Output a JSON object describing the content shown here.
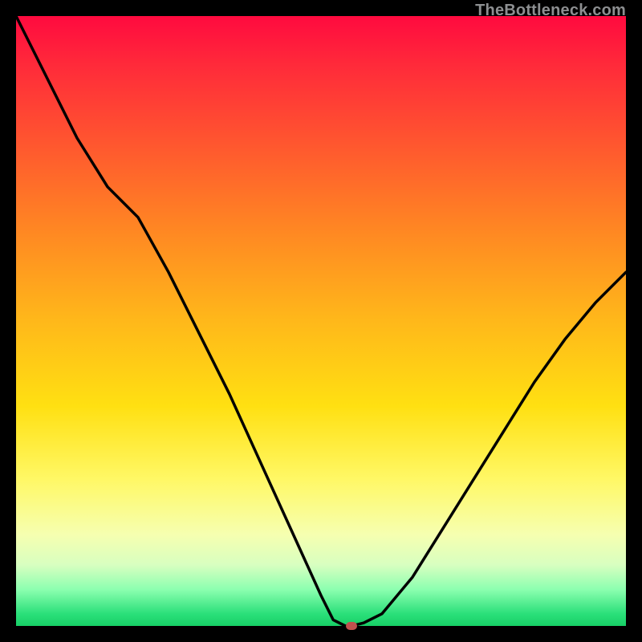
{
  "watermark": "TheBottleneck.com",
  "colors": {
    "frame_bg": "#000000",
    "gradient_top": "#ff0a3f",
    "gradient_bottom": "#17cf66",
    "curve_stroke": "#000000",
    "marker_fill": "#c0514e"
  },
  "chart_data": {
    "type": "line",
    "title": "",
    "xlabel": "",
    "ylabel": "",
    "xlim": [
      0,
      100
    ],
    "ylim": [
      0,
      100
    ],
    "x": [
      0,
      5,
      10,
      15,
      20,
      25,
      30,
      35,
      40,
      45,
      50,
      52,
      54,
      55,
      57,
      60,
      65,
      70,
      75,
      80,
      85,
      90,
      95,
      100
    ],
    "values": [
      100,
      90,
      80,
      72,
      67,
      58,
      48,
      38,
      27,
      16,
      5,
      1,
      0,
      0,
      0.5,
      2,
      8,
      16,
      24,
      32,
      40,
      47,
      53,
      58
    ],
    "marker": {
      "x": 55,
      "y": 0
    },
    "note": "y represents bottleneck %, background color maps y to red(top)->green(bottom)"
  }
}
